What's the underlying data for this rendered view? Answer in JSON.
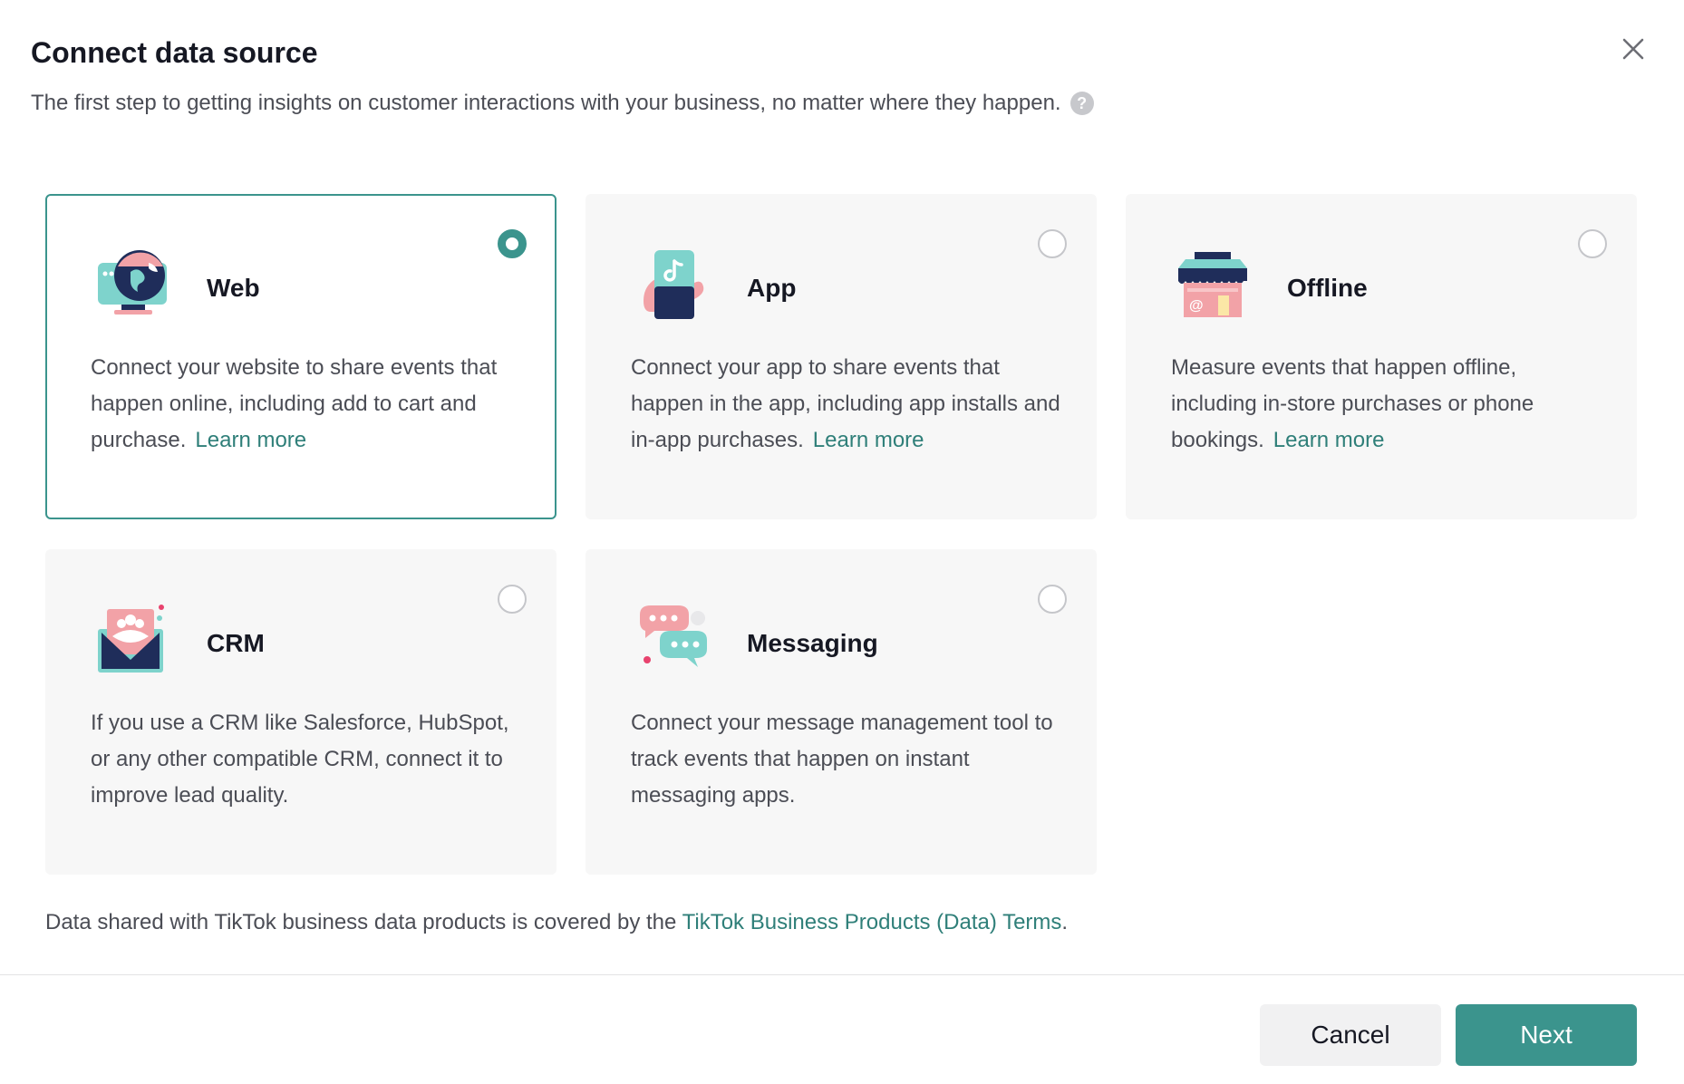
{
  "dialog": {
    "title": "Connect data source",
    "subtitle": "The first step to getting insights on customer interactions with your business, no matter where they happen."
  },
  "colors": {
    "accent": "#3b948d",
    "link": "#2f7f79",
    "card_bg": "#f7f7f7"
  },
  "cards": [
    {
      "title": "Web",
      "desc": "Connect your website to share events that happen online, including add to cart and purchase.",
      "link": "Learn more",
      "selected": true,
      "icon": "globe-monitor-icon"
    },
    {
      "title": "App",
      "desc": "Connect your app to share events that happen in the app, including app installs and in-app purchases.",
      "link": "Learn more",
      "selected": false,
      "icon": "phone-app-icon"
    },
    {
      "title": "Offline",
      "desc": "Measure events that happen offline, including in-store purchases or phone bookings.",
      "link": "Learn more",
      "selected": false,
      "icon": "store-icon"
    },
    {
      "title": "CRM",
      "desc": "If you use a CRM like Salesforce, HubSpot, or any other compatible CRM, connect it to improve lead quality.",
      "selected": false,
      "icon": "crm-envelope-icon"
    },
    {
      "title": "Messaging",
      "desc": "Connect your message management tool to track events that happen on instant messaging apps.",
      "selected": false,
      "icon": "chat-bubbles-icon"
    }
  ],
  "footnote": {
    "text": "Data shared with TikTok business data products is covered by the ",
    "link": "TikTok Business Products (Data) Terms",
    "end": "."
  },
  "buttons": {
    "cancel": "Cancel",
    "next": "Next"
  }
}
